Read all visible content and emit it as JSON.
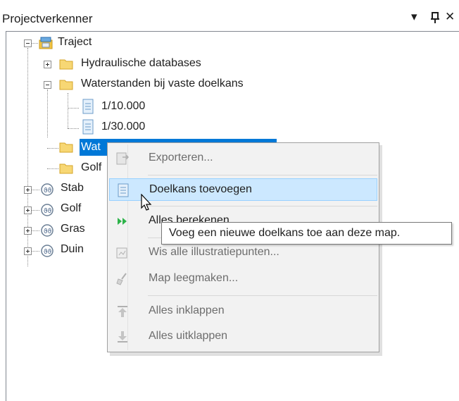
{
  "panel": {
    "title": "Projectverkenner",
    "buttons": {
      "dropdown": "▾",
      "pin": "ᛘ",
      "close": "✕"
    }
  },
  "tree": {
    "root": "Traject",
    "nodes": {
      "hydraulische": "Hydraulische databases",
      "waterstanden_vast": "Waterstanden bij vaste doelkans",
      "child_1": "1/10.000",
      "child_2": "1/30.000",
      "selected_partial": "Wat",
      "golf_folder_partial": "Golf",
      "stab_partial": "Stab",
      "golf2_partial": "Golf",
      "gras_partial": "Gras",
      "duin_partial": "Duin"
    }
  },
  "context_menu": {
    "items": [
      {
        "label": "Exporteren...",
        "enabled": false,
        "icon": "export-icon"
      },
      {
        "label": "Doelkans toevoegen",
        "enabled": true,
        "icon": "add-document-icon"
      },
      {
        "label": "Alles berekenen",
        "enabled": true,
        "icon": "run-all-icon"
      },
      {
        "label": "Wis alle illustratiepunten...",
        "enabled": false,
        "icon": "clear-illustration-icon"
      },
      {
        "label": "Map leegmaken...",
        "enabled": false,
        "icon": "broom-icon"
      },
      {
        "label": "Alles inklappen",
        "enabled": false,
        "icon": "collapse-all-icon"
      },
      {
        "label": "Alles uitklappen",
        "enabled": false,
        "icon": "expand-all-icon"
      }
    ]
  },
  "tooltip": {
    "text": "Voeg een nieuwe doelkans toe aan deze map."
  },
  "colors": {
    "selection": "#0078d7",
    "menu_highlight": "#cce8ff",
    "folder": "#f4c542",
    "run_green": "#2db34a"
  }
}
